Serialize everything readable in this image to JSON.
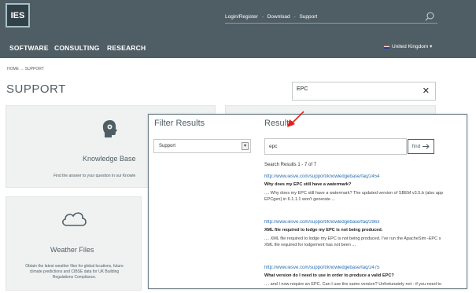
{
  "header": {
    "logo_text": "IES",
    "links": [
      "Login/Register",
      "Download",
      "Support"
    ],
    "separator": "-"
  },
  "nav": {
    "items": [
      "SOFTWARE",
      "CONSULTING",
      "RESEARCH"
    ],
    "region": "United Kingdom"
  },
  "breadcrumb": {
    "home": "HOME",
    "arrow": "→",
    "current": "SUPPORT"
  },
  "page": {
    "title": "SUPPORT"
  },
  "search": {
    "value": "EPC"
  },
  "cards": {
    "knowledge_base": {
      "title": "Knowledge Base",
      "desc": "Find the answer to your question in our Knowle"
    },
    "weather_files": {
      "title": "Weather Files",
      "desc": [
        "Obtain the latest weather files for global locations, future",
        "climate predictions and CIBSE data for UK Building",
        "Regulations Compliance."
      ]
    }
  },
  "overlay": {
    "filter_title": "Filter Results",
    "filter_value": "Support",
    "results_title": "Results",
    "query": "epc",
    "find_label": "find",
    "count": "Search Results 1 - 7 of 7",
    "results": [
      {
        "url": "http://www.iesve.com/support/knowledgebase/faq/2454",
        "question": "Why does my EPC still have a watermark?",
        "snippet": [
          ".... Why does my EPC still have a watermark? The updated version of SBEM v3.5.b (also app",
          "EPCgen) in 6.1.1.1 won't generate ..."
        ]
      },
      {
        "url": "http://www.iesve.com/support/knowledgebase/faq/2963",
        "question": "XML file required to lodge my EPC is not being produced.",
        "snippet": [
          ".... XML file required to lodge my EPC is not being produced. I've run the ApacheSim -EPC s",
          "XML file required for lodgement has not been ..."
        ]
      },
      {
        "url": "http://www.iesve.com/support/knowledgebase/faq/2475",
        "question": "What version do I need to use in order to produce a valid EPC?",
        "snippet": [
          ".... and I now require an EPC. Can I use the same version? Unfortunately not - if you need to"
        ]
      }
    ]
  },
  "colors": {
    "header_bg": "#4f5e64",
    "accent_arrow": "#e0201b",
    "link": "#2a6fb0"
  }
}
